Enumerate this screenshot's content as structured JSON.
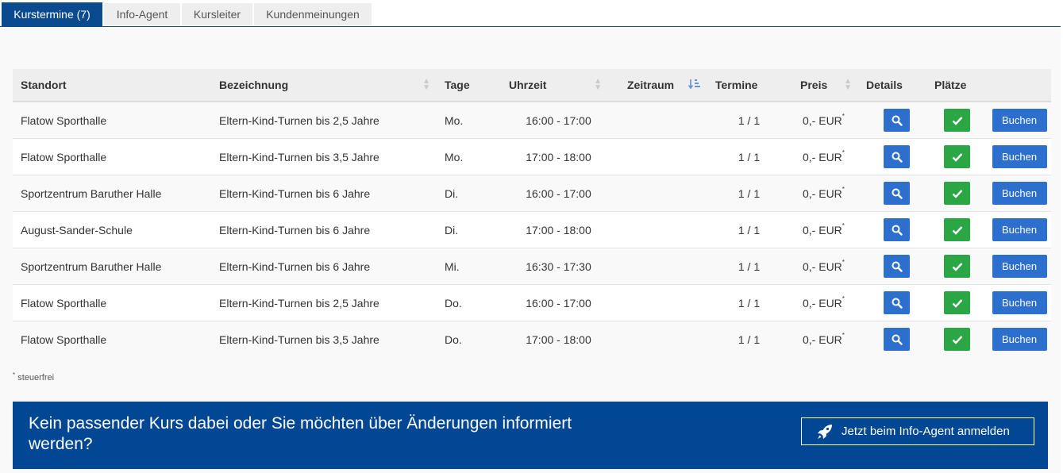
{
  "tabs": [
    {
      "label": "Kurstermine (7)"
    },
    {
      "label": "Info-Agent"
    },
    {
      "label": "Kursleiter"
    },
    {
      "label": "Kundenmeinungen"
    }
  ],
  "table": {
    "headers": {
      "standort": "Standort",
      "bezeichnung": "Bezeichnung",
      "tage": "Tage",
      "uhrzeit": "Uhrzeit",
      "zeitraum": "Zeitraum",
      "termine": "Termine",
      "preis": "Preis",
      "details": "Details",
      "plaetze": "Plätze"
    },
    "rows": [
      {
        "standort": "Flatow Sporthalle",
        "bezeichnung": "Eltern-Kind-Turnen bis 2,5 Jahre",
        "tage": "Mo.",
        "uhrzeit": "16:00 - 17:00",
        "termine": "1 / 1",
        "preis": "0,- EUR",
        "book": "Buchen"
      },
      {
        "standort": "Flatow Sporthalle",
        "bezeichnung": "Eltern-Kind-Turnen bis 3,5 Jahre",
        "tage": "Mo.",
        "uhrzeit": "17:00 - 18:00",
        "termine": "1 / 1",
        "preis": "0,- EUR",
        "book": "Buchen"
      },
      {
        "standort": "Sportzentrum Baruther Halle",
        "bezeichnung": "Eltern-Kind-Turnen bis 6 Jahre",
        "tage": "Di.",
        "uhrzeit": "16:00 - 17:00",
        "termine": "1 / 1",
        "preis": "0,- EUR",
        "book": "Buchen"
      },
      {
        "standort": "August-Sander-Schule",
        "bezeichnung": "Eltern-Kind-Turnen bis 6 Jahre",
        "tage": "Di.",
        "uhrzeit": "17:00 - 18:00",
        "termine": "1 / 1",
        "preis": "0,- EUR",
        "book": "Buchen"
      },
      {
        "standort": "Sportzentrum Baruther Halle",
        "bezeichnung": "Eltern-Kind-Turnen bis 6 Jahre",
        "tage": "Mi.",
        "uhrzeit": "16:30 - 17:30",
        "termine": "1 / 1",
        "preis": "0,- EUR",
        "book": "Buchen"
      },
      {
        "standort": "Flatow Sporthalle",
        "bezeichnung": "Eltern-Kind-Turnen bis 2,5 Jahre",
        "tage": "Do.",
        "uhrzeit": "16:00 - 17:00",
        "termine": "1 / 1",
        "preis": "0,- EUR",
        "book": "Buchen"
      },
      {
        "standort": "Flatow Sporthalle",
        "bezeichnung": "Eltern-Kind-Turnen bis 3,5 Jahre",
        "tage": "Do.",
        "uhrzeit": "17:00 - 18:00",
        "termine": "1 / 1",
        "preis": "0,- EUR",
        "book": "Buchen"
      }
    ]
  },
  "footnote": {
    "marker": "*",
    "text": "steuerfrei"
  },
  "banner": {
    "text": "Kein passender Kurs dabei oder Sie möchten über Änderungen informiert werden?",
    "button_label": "Jetzt beim Info-Agent anmelden"
  },
  "colors": {
    "brand_blue": "#024793",
    "button_blue": "#2c6fcd",
    "available_green": "#2aa744"
  },
  "icons": {
    "details": "search-icon",
    "plaetze": "check-icon",
    "banner": "rocket-icon",
    "zeitraum_sort": "sort-amount-icon"
  }
}
